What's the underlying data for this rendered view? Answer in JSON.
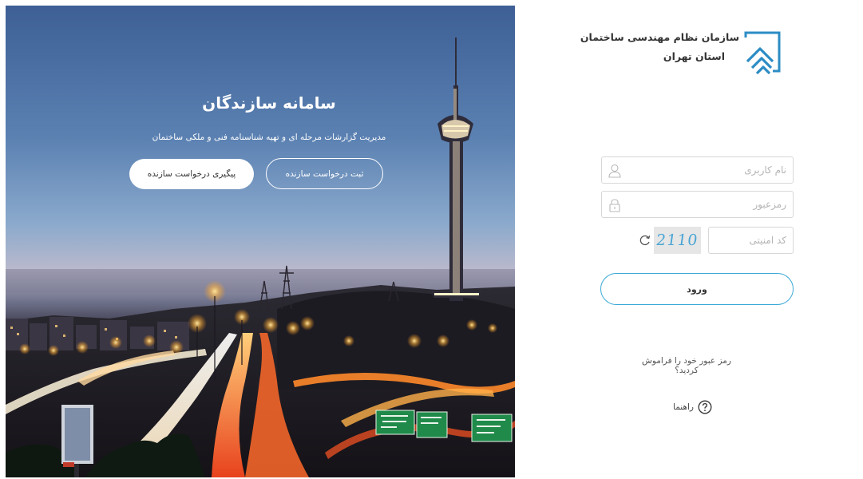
{
  "hero": {
    "title": "سامانه سازندگان",
    "subtitle": "مدیریت گزارشات مرحله ای و تهیه شناسنامه فنی و ملکی ساختمان",
    "register_button": "ثبت درخواست سازنده",
    "track_button": "پیگیری درخواست سازنده"
  },
  "logo": {
    "line1": "سازمان نظام مهندسی ساختمان",
    "line2": "استان تهران"
  },
  "login": {
    "username_placeholder": "نام کاربری",
    "password_placeholder": "رمزعبور",
    "captcha_placeholder": "کد امنیتی",
    "captcha_text": "2110",
    "submit_label": "ورود",
    "forgot_link": "رمز عبور خود را فراموش کردید؟",
    "help_label": "راهنما"
  },
  "colors": {
    "accent": "#3aa9d6",
    "field_border": "#d8d8d8",
    "captcha_bg": "#e6e6e6"
  },
  "icons": {
    "username": "user-icon",
    "password": "lock-icon",
    "refresh": "refresh-icon",
    "help": "question-circle-icon",
    "logo": "house-waves-logo"
  }
}
